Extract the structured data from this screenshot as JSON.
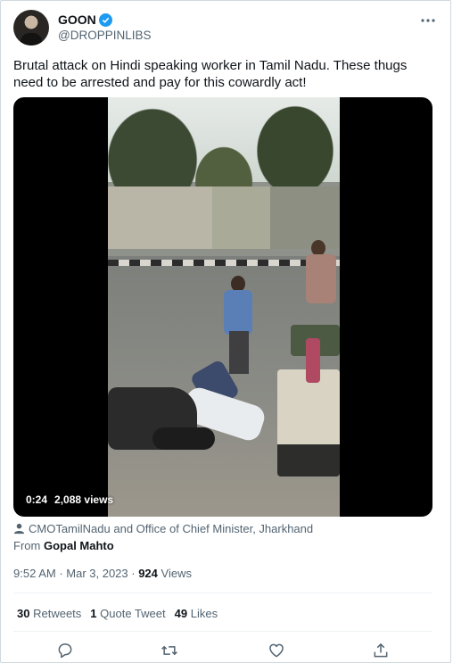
{
  "author": {
    "name": "GOON",
    "handle": "@DROPPINLIBS",
    "verified": true
  },
  "tweet": {
    "text": "Brutal attack on Hindi speaking worker in Tamil Nadu. These thugs need to be arrested and pay for this cowardly act!"
  },
  "video": {
    "duration": "0:24",
    "views": "2,088 views"
  },
  "attribution": {
    "tagged": "CMOTamilNadu and Office of Chief Minister, Jharkhand",
    "from_label": "From",
    "from_name": "Gopal Mahto"
  },
  "meta": {
    "time": "9:52 AM",
    "date": "Mar 3, 2023",
    "views_count": "924",
    "views_label": "Views"
  },
  "stats": {
    "retweets_count": "30",
    "retweets_label": "Retweets",
    "quotes_count": "1",
    "quotes_label": "Quote Tweet",
    "likes_count": "49",
    "likes_label": "Likes"
  },
  "colors": {
    "verified": "#1d9bf0",
    "secondary_text": "#536471",
    "primary_text": "#0f1419",
    "divider": "#eff3f4"
  },
  "icons": [
    "verified-badge-icon",
    "more-icon",
    "person-icon",
    "reply-icon",
    "retweet-icon",
    "like-icon",
    "share-icon"
  ]
}
